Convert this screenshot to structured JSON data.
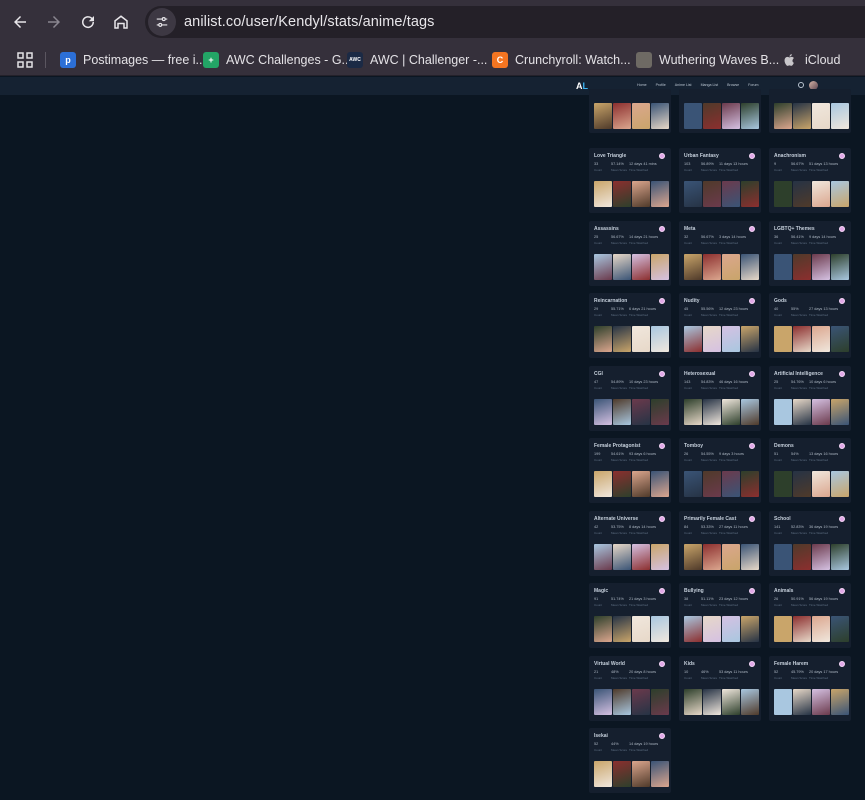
{
  "browser": {
    "url": "anilist.co/user/Kendyl/stats/anime/tags",
    "bookmarks": [
      {
        "label": "Postimages — free i...",
        "icon": "postimages-icon",
        "color": "#2c6fd6",
        "glyph": "p"
      },
      {
        "label": "AWC Challenges - G...",
        "icon": "sheets-icon",
        "color": "#23a566",
        "glyph": "+"
      },
      {
        "label": "AWC | Challenger -...",
        "icon": "awc-icon",
        "color": "#1b2a45",
        "glyph": "AWC"
      },
      {
        "label": "Crunchyroll: Watch...",
        "icon": "crunchyroll-icon",
        "color": "#f47521",
        "glyph": "C"
      },
      {
        "label": "Wuthering Waves B...",
        "icon": "wuthering-waves-icon",
        "color": "#6e6a64",
        "glyph": ""
      },
      {
        "label": "iCloud",
        "icon": "apple-icon",
        "color": "transparent",
        "glyph": ""
      }
    ]
  },
  "site": {
    "logo": "AL",
    "nav": [
      "Home",
      "Profile",
      "Anime List",
      "Manga List",
      "Browse",
      "Forum"
    ]
  },
  "labels": {
    "count": "Count",
    "mean": "Mean Score",
    "time": "Time Watched"
  },
  "tags": [
    {
      "name": "Love Triangle",
      "count": "33",
      "mean": "57.14%",
      "time": "12 days 41 mins"
    },
    {
      "name": "Urban Fantasy",
      "count": "103",
      "mean": "56.89%",
      "time": "11 days 13 hours"
    },
    {
      "name": "Anachronism",
      "count": "9",
      "mean": "56.67%",
      "time": "51 days 13 hours"
    },
    {
      "name": "Assassins",
      "count": "25",
      "mean": "56.67%",
      "time": "14 days 21 hours"
    },
    {
      "name": "Meta",
      "count": "32",
      "mean": "56.67%",
      "time": "3 days 14 hours"
    },
    {
      "name": "LGBTQ+ Themes",
      "count": "36",
      "mean": "56.41%",
      "time": "9 days 14 hours"
    },
    {
      "name": "Reincarnation",
      "count": "29",
      "mean": "55.71%",
      "time": "6 days 21 hours"
    },
    {
      "name": "Nudity",
      "count": "45",
      "mean": "55.56%",
      "time": "12 days 23 hours"
    },
    {
      "name": "Gods",
      "count": "40",
      "mean": "55%",
      "time": "27 days 13 hours"
    },
    {
      "name": "CGI",
      "count": "47",
      "mean": "54.89%",
      "time": "10 days 23 hours"
    },
    {
      "name": "Heterosexual",
      "count": "143",
      "mean": "54.83%",
      "time": "46 days 16 hours"
    },
    {
      "name": "Artificial Intelligence",
      "count": "25",
      "mean": "54.76%",
      "time": "10 days 6 hours"
    },
    {
      "name": "Female Protagonist",
      "count": "199",
      "mean": "54.61%",
      "time": "93 days 6 hours"
    },
    {
      "name": "Tomboy",
      "count": "26",
      "mean": "54.55%",
      "time": "9 days 3 hours"
    },
    {
      "name": "Demons",
      "count": "51",
      "mean": "54%",
      "time": "13 days 16 hours"
    },
    {
      "name": "Alternate Universe",
      "count": "42",
      "mean": "53.75%",
      "time": "8 days 14 hours"
    },
    {
      "name": "Primarily Female Cast",
      "count": "84",
      "mean": "53.33%",
      "time": "27 days 11 hours"
    },
    {
      "name": "School",
      "count": "141",
      "mean": "52.83%",
      "time": "36 days 19 hours"
    },
    {
      "name": "Magic",
      "count": "91",
      "mean": "51.74%",
      "time": "21 days 3 hours"
    },
    {
      "name": "Bullying",
      "count": "38",
      "mean": "51.11%",
      "time": "23 days 12 hours"
    },
    {
      "name": "Animals",
      "count": "26",
      "mean": "50.91%",
      "time": "56 days 19 hours"
    },
    {
      "name": "Virtual World",
      "count": "21",
      "mean": "48%",
      "time": "20 days 8 hours"
    },
    {
      "name": "Kids",
      "count": "10",
      "mean": "46%",
      "time": "53 days 11 hours"
    },
    {
      "name": "Female Harem",
      "count": "52",
      "mean": "45.79%",
      "time": "20 days 17 hours"
    },
    {
      "name": "Isekai",
      "count": "52",
      "mean": "44%",
      "time": "14 days 19 hours"
    }
  ],
  "cover_palette": [
    "#c9a56a",
    "#6b3a4c",
    "#e7d8c8",
    "#3a5476",
    "#f0e7dd",
    "#8c2f2f",
    "#2d3f2b",
    "#d5c1e2",
    "#4f3a2a",
    "#a9c7e0",
    "#dba68e",
    "#263345"
  ]
}
